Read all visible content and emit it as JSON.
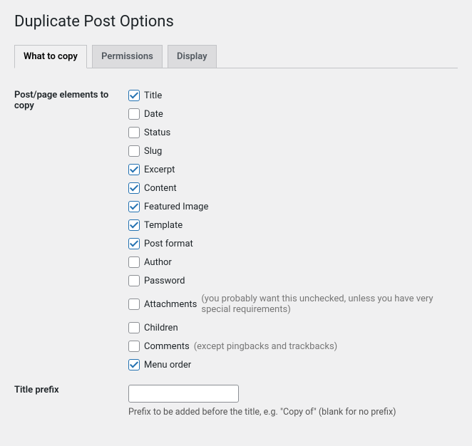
{
  "title": "Duplicate Post Options",
  "tabs": [
    {
      "label": "What to copy",
      "active": true
    },
    {
      "label": "Permissions",
      "active": false
    },
    {
      "label": "Display",
      "active": false
    }
  ],
  "section_elements_label": "Post/page elements to copy",
  "elements": [
    {
      "label": "Title",
      "checked": true,
      "hint": ""
    },
    {
      "label": "Date",
      "checked": false,
      "hint": ""
    },
    {
      "label": "Status",
      "checked": false,
      "hint": ""
    },
    {
      "label": "Slug",
      "checked": false,
      "hint": ""
    },
    {
      "label": "Excerpt",
      "checked": true,
      "hint": ""
    },
    {
      "label": "Content",
      "checked": true,
      "hint": ""
    },
    {
      "label": "Featured Image",
      "checked": true,
      "hint": ""
    },
    {
      "label": "Template",
      "checked": true,
      "hint": ""
    },
    {
      "label": "Post format",
      "checked": true,
      "hint": ""
    },
    {
      "label": "Author",
      "checked": false,
      "hint": ""
    },
    {
      "label": "Password",
      "checked": false,
      "hint": ""
    },
    {
      "label": "Attachments",
      "checked": false,
      "hint": "(you probably want this unchecked, unless you have very special requirements)"
    },
    {
      "label": "Children",
      "checked": false,
      "hint": ""
    },
    {
      "label": "Comments",
      "checked": false,
      "hint": "(except pingbacks and trackbacks)"
    },
    {
      "label": "Menu order",
      "checked": true,
      "hint": ""
    }
  ],
  "title_prefix": {
    "label": "Title prefix",
    "value": "",
    "desc": "Prefix to be added before the title, e.g. \"Copy of\" (blank for no prefix)"
  }
}
